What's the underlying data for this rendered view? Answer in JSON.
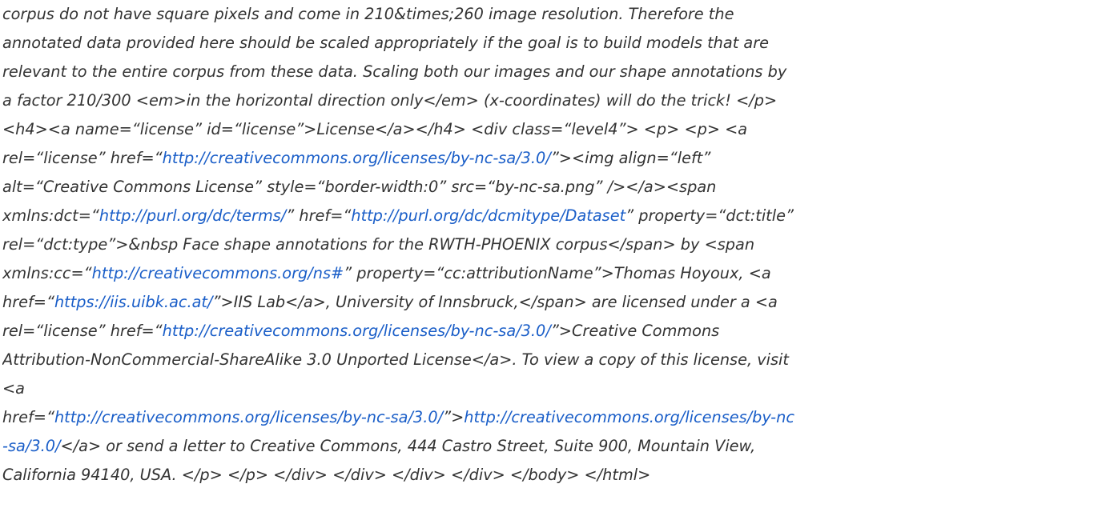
{
  "links": {
    "cc_license": "http://creativecommons.org/licenses/by-nc-sa/3.0/",
    "dc_terms": "http://purl.org/dc/terms/",
    "dc_dataset": "http://purl.org/dc/dcmitype/Dataset",
    "cc_ns": "http://creativecommons.org/ns#",
    "iis_lab": "https://iis.uibk.ac.at/",
    "cc_license_text_part1": "http://creativecommons.org/licenses/by-nc",
    "cc_license_text_part2": "-sa/3.0/"
  },
  "lines": [
    {
      "t1": "corpus do not have square pixels and come in 210&times;260 image resolution. Therefore the"
    },
    {
      "t1": "annotated data provided here should be scaled appropriately if the goal is to build models that are"
    },
    {
      "t1": "relevant to the entire corpus from these data. Scaling both our images and our shape annotations by"
    },
    {
      "t1": "a factor 210/300 <em>in the horizontal direction only</em> (x-coordinates) will do the trick! </p>"
    },
    {
      "t1": "<h4><a name=“license” id=“license”>License</a></h4> <div class=“level4”> <p> <p> <a"
    },
    {
      "t1": "rel=“license” href=“",
      "t2": "”><img align=“left”"
    },
    {
      "t1": "alt=“Creative Commons License” style=“border-width:0” src=“by-nc-sa.png” /></a><span"
    },
    {
      "t1": "xmlns:dct=“",
      "t2": "” href=“",
      "t3": "” property=“dct:title”"
    },
    {
      "t1": "rel=“dct:type”>&nbsp Face shape annotations for the RWTH-PHOENIX corpus</span> by <span"
    },
    {
      "t1": "xmlns:cc=“",
      "t2": "” property=“cc:attributionName”>Thomas Hoyoux, <a"
    },
    {
      "t1": "href=“",
      "t2": "”>IIS Lab</a>, University of Innsbruck,</span> are licensed under a <a"
    },
    {
      "t1": "rel=“license” href=“",
      "t2": "”>Creative Commons"
    },
    {
      "t1": "Attribution-NonCommercial-ShareAlike 3.0 Unported License</a>. To view a copy of this license, visit"
    },
    {
      "t1": "<a"
    },
    {
      "t1": "href=“",
      "t2": "”>"
    },
    {
      "t2": "</a> or send a letter to Creative Commons, 444 Castro Street, Suite 900, Mountain View,"
    },
    {
      "t1": "California 94140, USA. </p> </p> </div> </div> </div> </div> </body> </html>"
    }
  ]
}
